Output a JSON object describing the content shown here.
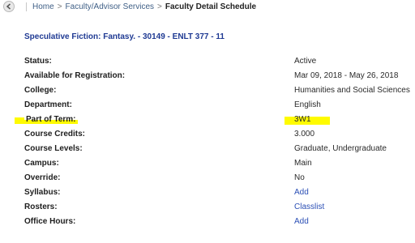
{
  "breadcrumb": {
    "home": "Home",
    "services": "Faculty/Advisor Services",
    "current": "Faculty Detail Schedule",
    "separator": ">"
  },
  "course": {
    "title": "Speculative Fiction: Fantasy. - 30149 - ENLT 377 - 11"
  },
  "details": {
    "status": {
      "label": "Status:",
      "value": "Active"
    },
    "registration": {
      "label": "Available for Registration:",
      "value": "Mar 09, 2018 - May 26, 2018"
    },
    "college": {
      "label": "College:",
      "value": "Humanities and Social Sciences"
    },
    "department": {
      "label": "Department:",
      "value": "English"
    },
    "part_of_term": {
      "label": "Part of Term:",
      "value": "3W1"
    },
    "credits": {
      "label": "Course Credits:",
      "value": "3.000"
    },
    "levels": {
      "label": "Course Levels:",
      "value": "Graduate, Undergraduate"
    },
    "campus": {
      "label": "Campus:",
      "value": "Main"
    },
    "override": {
      "label": "Override:",
      "value": "No"
    },
    "syllabus": {
      "label": "Syllabus:",
      "value": "Add"
    },
    "rosters": {
      "label": "Rosters:",
      "value": "Classlist"
    },
    "office_hours": {
      "label": "Office Hours:",
      "value": "Add"
    }
  },
  "colors": {
    "highlight": "#fffb00",
    "title": "#1f3a93",
    "link": "#2b4fb5"
  },
  "icons": {
    "back": "arrow-left-icon"
  }
}
